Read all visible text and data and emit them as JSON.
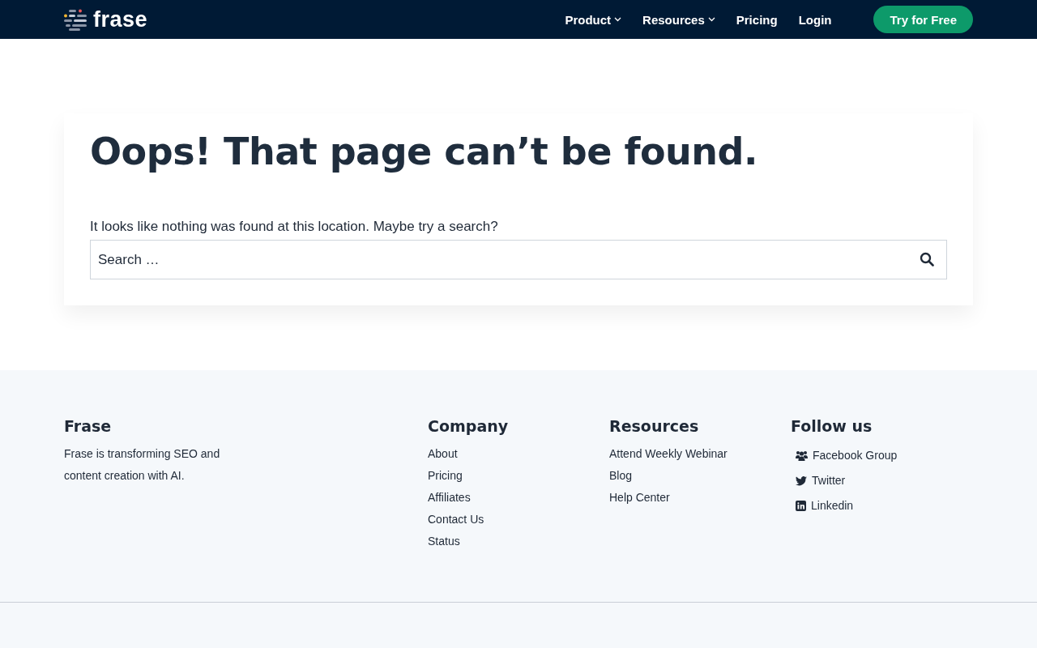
{
  "header": {
    "logo": "frase",
    "nav": [
      {
        "label": "Product",
        "has_menu": true
      },
      {
        "label": "Resources",
        "has_menu": true
      },
      {
        "label": "Pricing",
        "has_menu": false
      },
      {
        "label": "Login",
        "has_menu": false
      }
    ],
    "cta": "Try for Free"
  },
  "error": {
    "title": "Oops! That page can’t be found.",
    "message": "It looks like nothing was found at this location. Maybe try a search?",
    "search": {
      "placeholder": "Search …"
    }
  },
  "footer": {
    "about": {
      "heading": "Frase",
      "text": "Frase is transforming SEO and content creation with AI."
    },
    "columns": [
      {
        "heading": "Company",
        "links": [
          "About",
          "Pricing",
          "Affiliates",
          "Contact Us",
          "Status"
        ]
      },
      {
        "heading": "Resources",
        "links": [
          "Attend Weekly Webinar",
          "Blog",
          "Help Center"
        ]
      }
    ],
    "social": {
      "heading": "Follow us",
      "links": [
        {
          "kind": "group",
          "label": "Facebook Group"
        },
        {
          "kind": "bird",
          "label": "Twitter"
        },
        {
          "kind": "in",
          "label": "Linkedin"
        }
      ]
    }
  }
}
